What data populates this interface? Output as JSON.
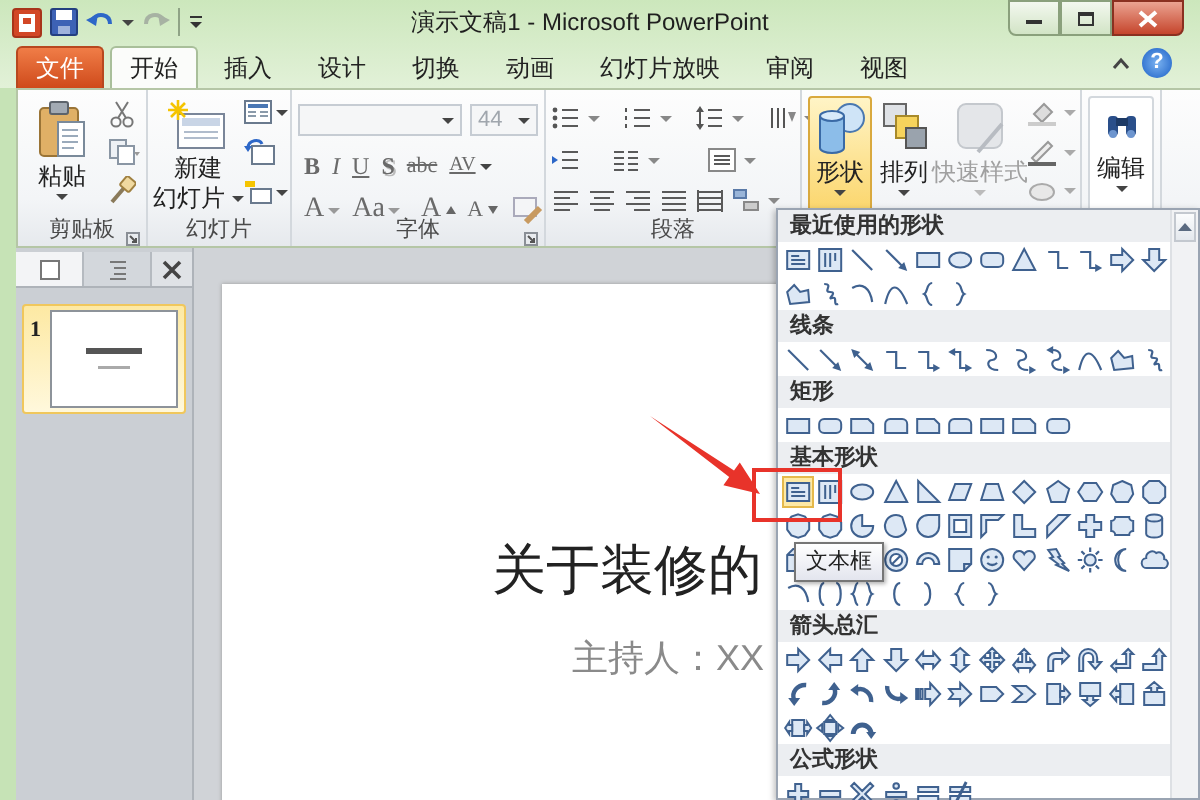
{
  "title_bar": {
    "title": "演示文稿1 - Microsoft PowerPoint"
  },
  "tabs": [
    {
      "label": "文件",
      "kind": "file",
      "selected": false
    },
    {
      "label": "开始",
      "kind": "tab",
      "selected": true
    },
    {
      "label": "插入",
      "kind": "tab",
      "selected": false
    },
    {
      "label": "设计",
      "kind": "tab",
      "selected": false
    },
    {
      "label": "切换",
      "kind": "tab",
      "selected": false
    },
    {
      "label": "动画",
      "kind": "tab",
      "selected": false
    },
    {
      "label": "幻灯片放映",
      "kind": "tab",
      "selected": false
    },
    {
      "label": "审阅",
      "kind": "tab",
      "selected": false
    },
    {
      "label": "视图",
      "kind": "tab",
      "selected": false
    }
  ],
  "help": "?",
  "ribbon": {
    "clipboard": {
      "label": "剪贴板",
      "paste": "粘贴"
    },
    "slides": {
      "label": "幻灯片",
      "new_slide": "新建",
      "new_slide_line2": "幻灯片"
    },
    "font": {
      "label": "字体",
      "font_size": "44",
      "format_buttons": [
        "B",
        "I",
        "U",
        "S",
        "abc",
        "AV"
      ],
      "size_buttons": [
        "A",
        "Aa",
        "A",
        "A"
      ]
    },
    "paragraph": {
      "label": "段落"
    },
    "drawing": {
      "shapes": {
        "label": "形状",
        "pressed": true
      },
      "arrange": {
        "label": "排列",
        "pressed": false
      },
      "quick_styles": {
        "label": "快速样式",
        "disabled": true
      }
    },
    "editing": {
      "label": "编辑"
    }
  },
  "slide_pane": {
    "tabs": [
      {
        "kind": "slides",
        "selected": true
      },
      {
        "kind": "outline",
        "selected": false
      }
    ],
    "slides": [
      {
        "number": "1",
        "selected": true
      }
    ]
  },
  "slide": {
    "title": "关于装修的",
    "subtitle": "主持人：XX"
  },
  "shapes_gallery": {
    "sections": [
      {
        "title": "最近使用的形状",
        "kind": "recent"
      },
      {
        "title": "线条",
        "kind": "lines"
      },
      {
        "title": "矩形",
        "kind": "rectangles"
      },
      {
        "title": "基本形状",
        "kind": "basic",
        "tooltip": "文本框"
      },
      {
        "title": "箭头总汇",
        "kind": "arrows"
      },
      {
        "title": "公式形状",
        "kind": "equation"
      }
    ]
  }
}
